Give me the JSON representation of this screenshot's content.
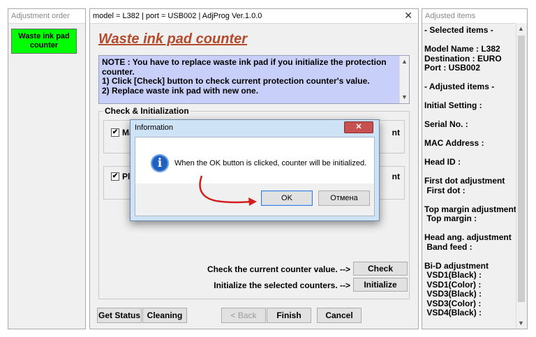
{
  "left_window": {
    "title": "Adjustment order",
    "green_button": "Waste ink pad counter"
  },
  "main_window": {
    "title": "model = L382 | port = USB002 | AdjProg Ver.1.0.0",
    "close": "✕",
    "heading": "Waste ink pad counter",
    "note": [
      "NOTE : You have to replace waste ink pad if you initialize the protection",
      "counter.",
      "1) Click [Check] button to check current protection counter's value.",
      "2) Replace waste ink pad with new one."
    ],
    "group_label": "Check & Initialization",
    "rows": [
      {
        "checked": "✔",
        "label": "Ma",
        "tail": "nt"
      },
      {
        "checked": "✔",
        "label": "Pla",
        "tail": "nt"
      }
    ],
    "check_text": "Check the current counter value. -->",
    "check_btn": "Check",
    "init_text": "Initialize the selected counters. -->",
    "init_btn": "Initialize",
    "bottom_buttons": {
      "get_status": "Get Status",
      "cleaning": "Cleaning",
      "back": "< Back",
      "finish": "Finish",
      "cancel": "Cancel"
    }
  },
  "right_window": {
    "title": "Adjusted items",
    "lines": [
      "- Selected items -",
      "",
      "Model Name : L382",
      "Destination : EURO",
      "Port : USB002",
      "",
      "- Adjusted items -",
      "",
      "Initial Setting :",
      "",
      "Serial No. :",
      "",
      "MAC Address :",
      "",
      "Head ID :",
      "",
      "First dot adjustment",
      " First dot :",
      "",
      "Top margin adjustment",
      " Top margin :",
      "",
      "Head ang. adjustment",
      " Band feed :",
      "",
      "Bi-D adjustment",
      " VSD1(Black) :",
      " VSD1(Color) :",
      " VSD3(Black) :",
      " VSD3(Color) :",
      " VSD4(Black) :"
    ]
  },
  "dialog": {
    "title": "Information",
    "close": "✕",
    "icon_glyph": "i",
    "message": "When the OK button is clicked, counter will be initialized.",
    "ok": "OK",
    "cancel": "Отмена"
  },
  "colors": {
    "accent_green": "#00ff00",
    "heading": "#b34a2c",
    "note_bg": "#c8cff8",
    "arrow": "#d21e1e"
  }
}
